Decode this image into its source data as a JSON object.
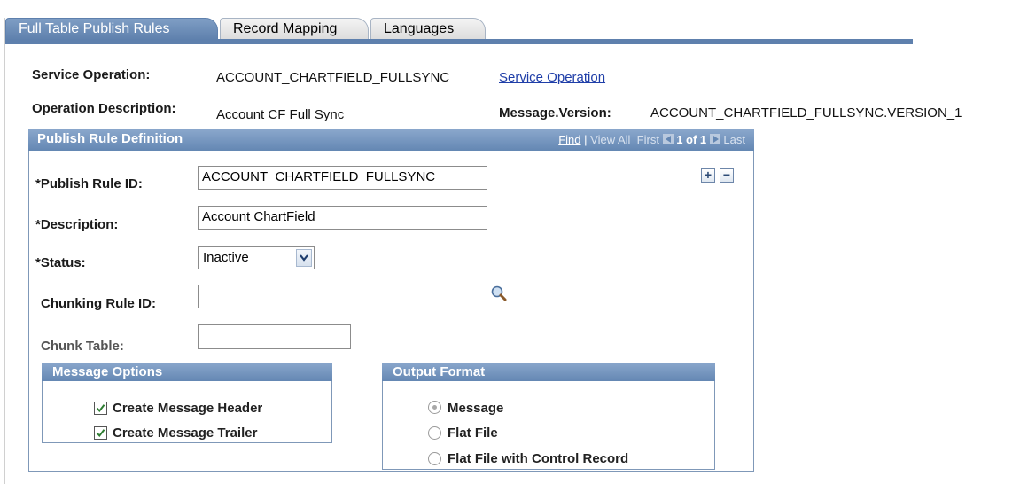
{
  "tabs": [
    {
      "label": "Full Table Publish Rules",
      "active": true
    },
    {
      "label": "Record Mapping",
      "active": false
    },
    {
      "label": "Languages",
      "active": false
    }
  ],
  "header": {
    "service_operation_label": "Service Operation:",
    "service_operation_value": "ACCOUNT_CHARTFIELD_FULLSYNC",
    "service_operation_link": "Service Operation",
    "operation_description_label": "Operation Description:",
    "operation_description_value": "Account CF Full Sync",
    "message_version_label": "Message.Version:",
    "message_version_value": "ACCOUNT_CHARTFIELD_FULLSYNC.VERSION_1"
  },
  "group": {
    "title": "Publish Rule Definition",
    "nav": {
      "find": "Find",
      "sep": "|",
      "view_all": "View All",
      "first": "First",
      "count": "1 of 1",
      "last": "Last"
    },
    "add_symbol": "+",
    "remove_symbol": "−"
  },
  "form": {
    "publish_rule_id_label": "*Publish Rule ID:",
    "publish_rule_id_value": "ACCOUNT_CHARTFIELD_FULLSYNC",
    "description_label": "*Description:",
    "description_value": "Account ChartField",
    "status_label": "*Status:",
    "status_value": "Inactive",
    "chunking_rule_label": "Chunking Rule ID:",
    "chunking_rule_value": "",
    "chunk_table_label": "Chunk Table:",
    "chunk_table_value": ""
  },
  "message_options": {
    "title": "Message Options",
    "items": [
      {
        "label": "Create Message Header",
        "checked": true
      },
      {
        "label": "Create Message Trailer",
        "checked": true
      }
    ]
  },
  "output_format": {
    "title": "Output Format",
    "options": [
      {
        "label": "Message",
        "selected": true
      },
      {
        "label": "Flat File",
        "selected": false
      },
      {
        "label": "Flat File with Control Record",
        "selected": false
      }
    ]
  },
  "colors": {
    "tab_active": "#5e80ad",
    "header_gradient_top": "#8aa7cc",
    "header_gradient_bottom": "#6487b3",
    "link": "#1f3ea8",
    "check": "#2e7d32"
  },
  "icons": {
    "lookup": "magnifier-icon",
    "dropdown": "chevron-down-icon",
    "add": "plus-icon",
    "remove": "minus-icon",
    "first": "arrow-left-icon",
    "last": "arrow-right-icon"
  }
}
